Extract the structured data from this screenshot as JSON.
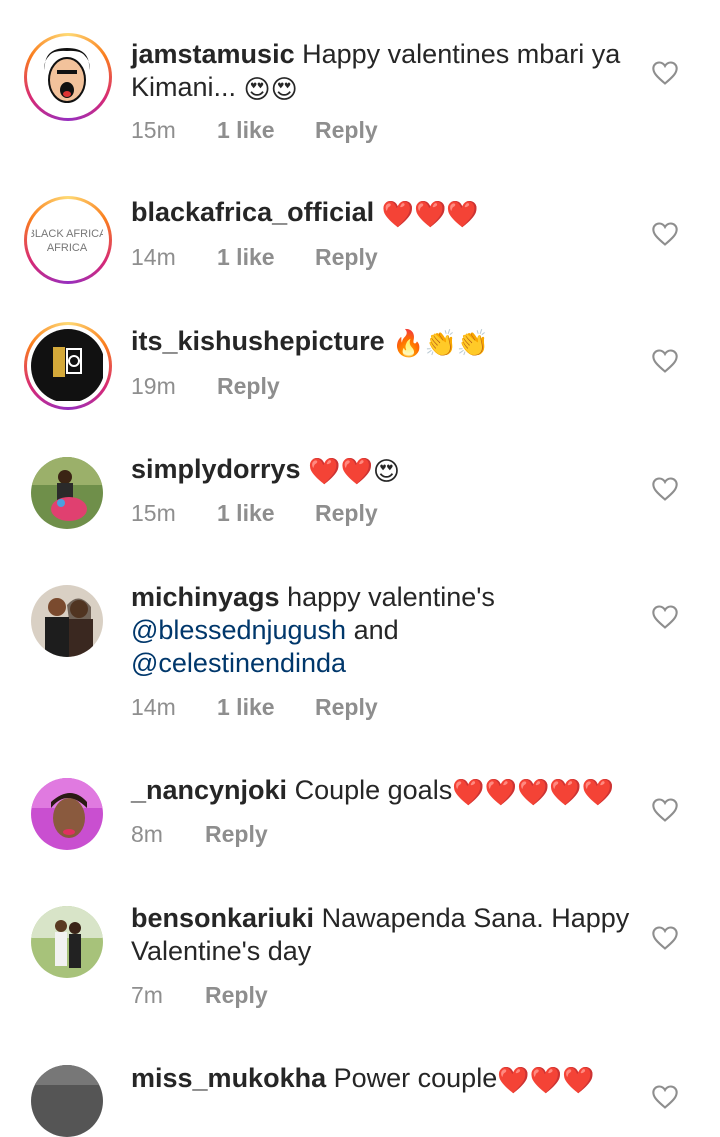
{
  "comments": [
    {
      "username": "jamstamusic",
      "text": "Happy valentines mbari ya Kimani... ",
      "emoji": "😍😍",
      "time": "15m",
      "likes": "1 like",
      "reply": "Reply"
    },
    {
      "username": "blackafrica_official",
      "text": "",
      "emoji": "❤️❤️❤️",
      "time": "14m",
      "likes": "1 like",
      "reply": "Reply"
    },
    {
      "username": "its_kishushepicture",
      "text": "",
      "emoji": "🔥👏👏",
      "time": "19m",
      "likes": "",
      "reply": "Reply"
    },
    {
      "username": "simplydorrys",
      "text": "",
      "emoji": "❤️❤️😍",
      "time": "15m",
      "likes": "1 like",
      "reply": "Reply"
    },
    {
      "username": "michinyags",
      "text": "happy valentine's",
      "mention1": "@blessednjugush",
      "and": " and",
      "mention2": "@celestinendinda",
      "time": "14m",
      "likes": "1 like",
      "reply": "Reply"
    },
    {
      "username": "_nancynjoki",
      "text": "Couple goals",
      "emoji": "❤️❤️❤️❤️❤️",
      "time": "8m",
      "likes": "",
      "reply": "Reply"
    },
    {
      "username": "bensonkariuki",
      "text": "Nawapenda Sana. Happy Valentine's day",
      "time": "7m",
      "likes": "",
      "reply": "Reply"
    },
    {
      "username": "miss_mukokha",
      "text": "Power couple",
      "emoji": "❤️❤️❤️",
      "time": "",
      "likes": "",
      "reply": ""
    }
  ],
  "avatar_logo_text": "BLACK AFRICA",
  "colors": {
    "username": "#262626",
    "meta": "#8e8e8e",
    "mention": "#00376b",
    "heart_outline": "#8e8e8e"
  },
  "icons": {
    "like": "heart-outline-icon"
  }
}
